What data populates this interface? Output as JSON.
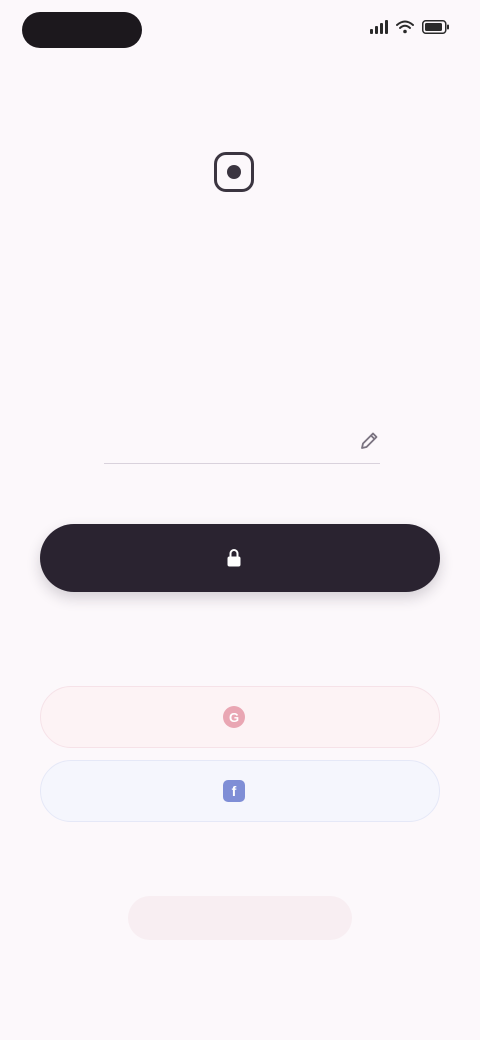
{
  "status_bar": {
    "time": "",
    "icons": [
      "signal-icon",
      "wifi-icon",
      "battery-icon"
    ]
  },
  "brand": {
    "logo_icon": "brand-logo-icon",
    "name": ""
  },
  "header": {
    "title": "",
    "subtitle": ""
  },
  "phone": {
    "country_code": "",
    "value": "",
    "edit_icon": "pencil-icon"
  },
  "primary_action": {
    "icon": "lock-icon",
    "label": ""
  },
  "social": {
    "google": {
      "icon": "google-icon",
      "label": ""
    },
    "facebook": {
      "icon": "facebook-icon",
      "label": ""
    }
  },
  "terms_text": "",
  "secondary_link": {
    "label": ""
  },
  "colors": {
    "background": "#fcf8fb",
    "primary_button": "#2a2330",
    "google_tint": "#fdf3f5",
    "facebook_tint": "#f5f6fd",
    "secondary_link_tint": "#f8eef2"
  }
}
